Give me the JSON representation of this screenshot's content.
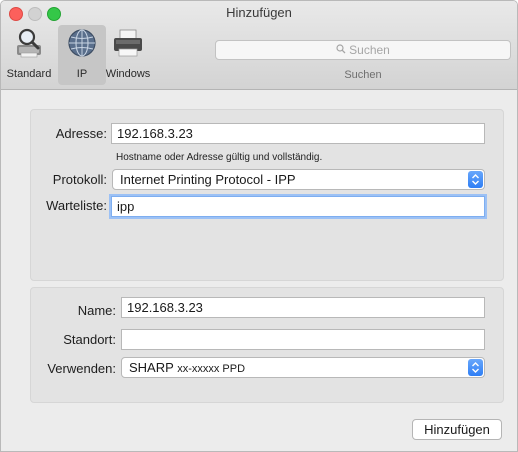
{
  "window": {
    "title": "Hinzufügen"
  },
  "toolbar": {
    "items": [
      {
        "label": "Standard",
        "icon": "magnifier-printer-icon"
      },
      {
        "label": "IP",
        "icon": "globe-icon",
        "selected": true
      },
      {
        "label": "Windows",
        "icon": "printer-icon"
      }
    ],
    "search": {
      "placeholder": "Suchen",
      "caption": "Suchen"
    }
  },
  "form_top": {
    "address_label": "Adresse:",
    "address_value": "192.168.3.23",
    "address_hint": "Hostname oder Adresse gültig und vollständig.",
    "protocol_label": "Protokoll:",
    "protocol_value": "Internet Printing Protocol - IPP",
    "queue_label": "Warteliste:",
    "queue_value": "ipp"
  },
  "form_bottom": {
    "name_label": "Name:",
    "name_value": "192.168.3.23",
    "location_label": "Standort:",
    "location_value": "",
    "use_label": "Verwenden:",
    "use_value_prefix": "SHARP",
    "use_value_suffix": "xx-xxxxx PPD"
  },
  "buttons": {
    "add_label": "Hinzufügen"
  },
  "colors": {
    "accent": "#2e7ef5",
    "close": "#fc605c",
    "zoom": "#34c748",
    "focus_ring": "#9cc1f5"
  }
}
